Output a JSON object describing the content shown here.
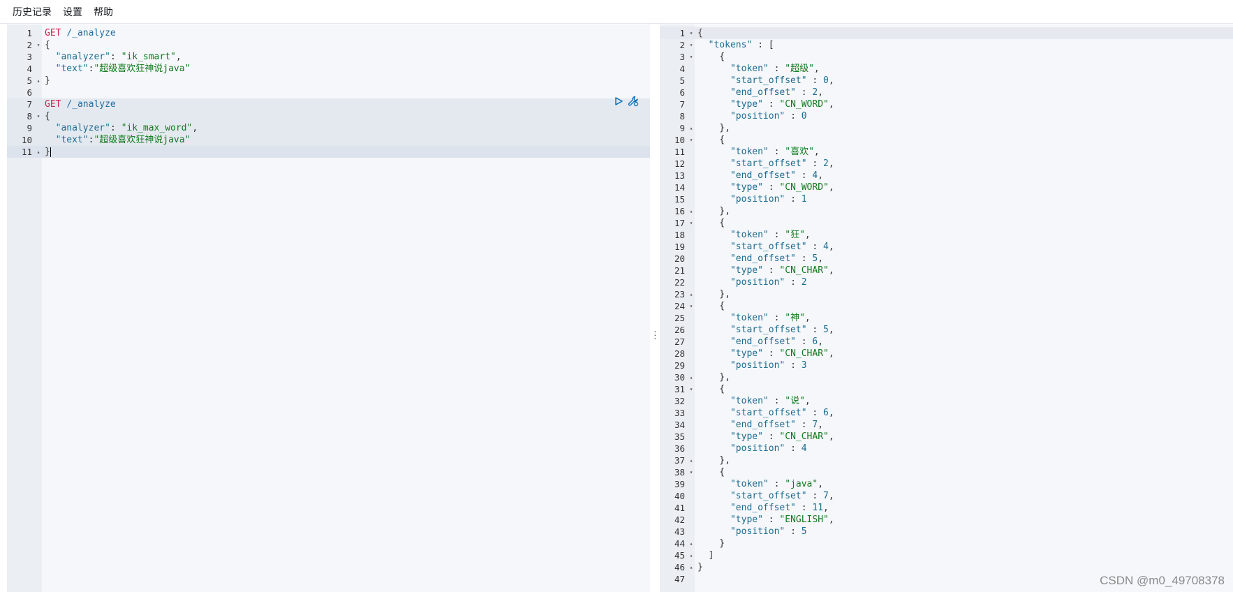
{
  "menubar": {
    "items": [
      "历史记录",
      "设置",
      "帮助"
    ]
  },
  "left_editor": {
    "lines": [
      {
        "n": "1",
        "fold": "",
        "tokens": [
          [
            "k-method",
            "GET"
          ],
          [
            "k-punc",
            " "
          ],
          [
            "k-path",
            "/_analyze"
          ]
        ]
      },
      {
        "n": "2",
        "fold": "▾",
        "tokens": [
          [
            "k-punc",
            "{"
          ]
        ]
      },
      {
        "n": "3",
        "fold": "",
        "tokens": [
          [
            "k-punc",
            "  "
          ],
          [
            "k-key",
            "\"analyzer\""
          ],
          [
            "k-punc",
            ": "
          ],
          [
            "k-str",
            "\"ik_smart\""
          ],
          [
            "k-punc",
            ","
          ]
        ]
      },
      {
        "n": "4",
        "fold": "",
        "tokens": [
          [
            "k-punc",
            "  "
          ],
          [
            "k-key",
            "\"text\""
          ],
          [
            "k-punc",
            ":"
          ],
          [
            "k-str",
            "\"超级喜欢狂神说java\""
          ]
        ]
      },
      {
        "n": "5",
        "fold": "▴",
        "tokens": [
          [
            "k-punc",
            "}"
          ]
        ]
      },
      {
        "n": "6",
        "fold": "",
        "tokens": []
      },
      {
        "n": "7",
        "fold": "",
        "tokens": [
          [
            "k-method",
            "GET"
          ],
          [
            "k-punc",
            " "
          ],
          [
            "k-path",
            "/_analyze"
          ]
        ],
        "hl": true
      },
      {
        "n": "8",
        "fold": "▾",
        "tokens": [
          [
            "k-punc",
            "{"
          ]
        ],
        "hl": true
      },
      {
        "n": "9",
        "fold": "",
        "tokens": [
          [
            "k-punc",
            "  "
          ],
          [
            "k-key",
            "\"analyzer\""
          ],
          [
            "k-punc",
            ": "
          ],
          [
            "k-str",
            "\"ik_max_word\""
          ],
          [
            "k-punc",
            ","
          ]
        ],
        "hl": true
      },
      {
        "n": "10",
        "fold": "",
        "tokens": [
          [
            "k-punc",
            "  "
          ],
          [
            "k-key",
            "\"text\""
          ],
          [
            "k-punc",
            ":"
          ],
          [
            "k-str",
            "\"超级喜欢狂神说java\""
          ]
        ],
        "hl": true
      },
      {
        "n": "11",
        "fold": "▴",
        "tokens": [
          [
            "k-punc",
            "}"
          ]
        ],
        "cur": true
      }
    ]
  },
  "right_editor": {
    "lines": [
      {
        "n": "1",
        "fold": "▾",
        "tokens": [
          [
            "k-punc",
            "{"
          ]
        ]
      },
      {
        "n": "2",
        "fold": "▾",
        "tokens": [
          [
            "k-punc",
            "  "
          ],
          [
            "k-key",
            "\"tokens\""
          ],
          [
            "k-punc",
            " : ["
          ]
        ]
      },
      {
        "n": "3",
        "fold": "▾",
        "tokens": [
          [
            "k-punc",
            "    {"
          ]
        ]
      },
      {
        "n": "4",
        "fold": "",
        "tokens": [
          [
            "k-punc",
            "      "
          ],
          [
            "k-key",
            "\"token\""
          ],
          [
            "k-punc",
            " : "
          ],
          [
            "k-str",
            "\"超级\""
          ],
          [
            "k-punc",
            ","
          ]
        ]
      },
      {
        "n": "5",
        "fold": "",
        "tokens": [
          [
            "k-punc",
            "      "
          ],
          [
            "k-key",
            "\"start_offset\""
          ],
          [
            "k-punc",
            " : "
          ],
          [
            "k-num",
            "0"
          ],
          [
            "k-punc",
            ","
          ]
        ]
      },
      {
        "n": "6",
        "fold": "",
        "tokens": [
          [
            "k-punc",
            "      "
          ],
          [
            "k-key",
            "\"end_offset\""
          ],
          [
            "k-punc",
            " : "
          ],
          [
            "k-num",
            "2"
          ],
          [
            "k-punc",
            ","
          ]
        ]
      },
      {
        "n": "7",
        "fold": "",
        "tokens": [
          [
            "k-punc",
            "      "
          ],
          [
            "k-key",
            "\"type\""
          ],
          [
            "k-punc",
            " : "
          ],
          [
            "k-str",
            "\"CN_WORD\""
          ],
          [
            "k-punc",
            ","
          ]
        ]
      },
      {
        "n": "8",
        "fold": "",
        "tokens": [
          [
            "k-punc",
            "      "
          ],
          [
            "k-key",
            "\"position\""
          ],
          [
            "k-punc",
            " : "
          ],
          [
            "k-num",
            "0"
          ]
        ]
      },
      {
        "n": "9",
        "fold": "▴",
        "tokens": [
          [
            "k-punc",
            "    },"
          ]
        ]
      },
      {
        "n": "10",
        "fold": "▾",
        "tokens": [
          [
            "k-punc",
            "    {"
          ]
        ]
      },
      {
        "n": "11",
        "fold": "",
        "tokens": [
          [
            "k-punc",
            "      "
          ],
          [
            "k-key",
            "\"token\""
          ],
          [
            "k-punc",
            " : "
          ],
          [
            "k-str",
            "\"喜欢\""
          ],
          [
            "k-punc",
            ","
          ]
        ]
      },
      {
        "n": "12",
        "fold": "",
        "tokens": [
          [
            "k-punc",
            "      "
          ],
          [
            "k-key",
            "\"start_offset\""
          ],
          [
            "k-punc",
            " : "
          ],
          [
            "k-num",
            "2"
          ],
          [
            "k-punc",
            ","
          ]
        ]
      },
      {
        "n": "13",
        "fold": "",
        "tokens": [
          [
            "k-punc",
            "      "
          ],
          [
            "k-key",
            "\"end_offset\""
          ],
          [
            "k-punc",
            " : "
          ],
          [
            "k-num",
            "4"
          ],
          [
            "k-punc",
            ","
          ]
        ]
      },
      {
        "n": "14",
        "fold": "",
        "tokens": [
          [
            "k-punc",
            "      "
          ],
          [
            "k-key",
            "\"type\""
          ],
          [
            "k-punc",
            " : "
          ],
          [
            "k-str",
            "\"CN_WORD\""
          ],
          [
            "k-punc",
            ","
          ]
        ]
      },
      {
        "n": "15",
        "fold": "",
        "tokens": [
          [
            "k-punc",
            "      "
          ],
          [
            "k-key",
            "\"position\""
          ],
          [
            "k-punc",
            " : "
          ],
          [
            "k-num",
            "1"
          ]
        ]
      },
      {
        "n": "16",
        "fold": "▴",
        "tokens": [
          [
            "k-punc",
            "    },"
          ]
        ]
      },
      {
        "n": "17",
        "fold": "▾",
        "tokens": [
          [
            "k-punc",
            "    {"
          ]
        ]
      },
      {
        "n": "18",
        "fold": "",
        "tokens": [
          [
            "k-punc",
            "      "
          ],
          [
            "k-key",
            "\"token\""
          ],
          [
            "k-punc",
            " : "
          ],
          [
            "k-str",
            "\"狂\""
          ],
          [
            "k-punc",
            ","
          ]
        ]
      },
      {
        "n": "19",
        "fold": "",
        "tokens": [
          [
            "k-punc",
            "      "
          ],
          [
            "k-key",
            "\"start_offset\""
          ],
          [
            "k-punc",
            " : "
          ],
          [
            "k-num",
            "4"
          ],
          [
            "k-punc",
            ","
          ]
        ]
      },
      {
        "n": "20",
        "fold": "",
        "tokens": [
          [
            "k-punc",
            "      "
          ],
          [
            "k-key",
            "\"end_offset\""
          ],
          [
            "k-punc",
            " : "
          ],
          [
            "k-num",
            "5"
          ],
          [
            "k-punc",
            ","
          ]
        ]
      },
      {
        "n": "21",
        "fold": "",
        "tokens": [
          [
            "k-punc",
            "      "
          ],
          [
            "k-key",
            "\"type\""
          ],
          [
            "k-punc",
            " : "
          ],
          [
            "k-str",
            "\"CN_CHAR\""
          ],
          [
            "k-punc",
            ","
          ]
        ]
      },
      {
        "n": "22",
        "fold": "",
        "tokens": [
          [
            "k-punc",
            "      "
          ],
          [
            "k-key",
            "\"position\""
          ],
          [
            "k-punc",
            " : "
          ],
          [
            "k-num",
            "2"
          ]
        ]
      },
      {
        "n": "23",
        "fold": "▴",
        "tokens": [
          [
            "k-punc",
            "    },"
          ]
        ]
      },
      {
        "n": "24",
        "fold": "▾",
        "tokens": [
          [
            "k-punc",
            "    {"
          ]
        ]
      },
      {
        "n": "25",
        "fold": "",
        "tokens": [
          [
            "k-punc",
            "      "
          ],
          [
            "k-key",
            "\"token\""
          ],
          [
            "k-punc",
            " : "
          ],
          [
            "k-str",
            "\"神\""
          ],
          [
            "k-punc",
            ","
          ]
        ]
      },
      {
        "n": "26",
        "fold": "",
        "tokens": [
          [
            "k-punc",
            "      "
          ],
          [
            "k-key",
            "\"start_offset\""
          ],
          [
            "k-punc",
            " : "
          ],
          [
            "k-num",
            "5"
          ],
          [
            "k-punc",
            ","
          ]
        ]
      },
      {
        "n": "27",
        "fold": "",
        "tokens": [
          [
            "k-punc",
            "      "
          ],
          [
            "k-key",
            "\"end_offset\""
          ],
          [
            "k-punc",
            " : "
          ],
          [
            "k-num",
            "6"
          ],
          [
            "k-punc",
            ","
          ]
        ]
      },
      {
        "n": "28",
        "fold": "",
        "tokens": [
          [
            "k-punc",
            "      "
          ],
          [
            "k-key",
            "\"type\""
          ],
          [
            "k-punc",
            " : "
          ],
          [
            "k-str",
            "\"CN_CHAR\""
          ],
          [
            "k-punc",
            ","
          ]
        ]
      },
      {
        "n": "29",
        "fold": "",
        "tokens": [
          [
            "k-punc",
            "      "
          ],
          [
            "k-key",
            "\"position\""
          ],
          [
            "k-punc",
            " : "
          ],
          [
            "k-num",
            "3"
          ]
        ]
      },
      {
        "n": "30",
        "fold": "▴",
        "tokens": [
          [
            "k-punc",
            "    },"
          ]
        ]
      },
      {
        "n": "31",
        "fold": "▾",
        "tokens": [
          [
            "k-punc",
            "    {"
          ]
        ]
      },
      {
        "n": "32",
        "fold": "",
        "tokens": [
          [
            "k-punc",
            "      "
          ],
          [
            "k-key",
            "\"token\""
          ],
          [
            "k-punc",
            " : "
          ],
          [
            "k-str",
            "\"说\""
          ],
          [
            "k-punc",
            ","
          ]
        ]
      },
      {
        "n": "33",
        "fold": "",
        "tokens": [
          [
            "k-punc",
            "      "
          ],
          [
            "k-key",
            "\"start_offset\""
          ],
          [
            "k-punc",
            " : "
          ],
          [
            "k-num",
            "6"
          ],
          [
            "k-punc",
            ","
          ]
        ]
      },
      {
        "n": "34",
        "fold": "",
        "tokens": [
          [
            "k-punc",
            "      "
          ],
          [
            "k-key",
            "\"end_offset\""
          ],
          [
            "k-punc",
            " : "
          ],
          [
            "k-num",
            "7"
          ],
          [
            "k-punc",
            ","
          ]
        ]
      },
      {
        "n": "35",
        "fold": "",
        "tokens": [
          [
            "k-punc",
            "      "
          ],
          [
            "k-key",
            "\"type\""
          ],
          [
            "k-punc",
            " : "
          ],
          [
            "k-str",
            "\"CN_CHAR\""
          ],
          [
            "k-punc",
            ","
          ]
        ]
      },
      {
        "n": "36",
        "fold": "",
        "tokens": [
          [
            "k-punc",
            "      "
          ],
          [
            "k-key",
            "\"position\""
          ],
          [
            "k-punc",
            " : "
          ],
          [
            "k-num",
            "4"
          ]
        ]
      },
      {
        "n": "37",
        "fold": "▴",
        "tokens": [
          [
            "k-punc",
            "    },"
          ]
        ]
      },
      {
        "n": "38",
        "fold": "▾",
        "tokens": [
          [
            "k-punc",
            "    {"
          ]
        ]
      },
      {
        "n": "39",
        "fold": "",
        "tokens": [
          [
            "k-punc",
            "      "
          ],
          [
            "k-key",
            "\"token\""
          ],
          [
            "k-punc",
            " : "
          ],
          [
            "k-str",
            "\"java\""
          ],
          [
            "k-punc",
            ","
          ]
        ]
      },
      {
        "n": "40",
        "fold": "",
        "tokens": [
          [
            "k-punc",
            "      "
          ],
          [
            "k-key",
            "\"start_offset\""
          ],
          [
            "k-punc",
            " : "
          ],
          [
            "k-num",
            "7"
          ],
          [
            "k-punc",
            ","
          ]
        ]
      },
      {
        "n": "41",
        "fold": "",
        "tokens": [
          [
            "k-punc",
            "      "
          ],
          [
            "k-key",
            "\"end_offset\""
          ],
          [
            "k-punc",
            " : "
          ],
          [
            "k-num",
            "11"
          ],
          [
            "k-punc",
            ","
          ]
        ]
      },
      {
        "n": "42",
        "fold": "",
        "tokens": [
          [
            "k-punc",
            "      "
          ],
          [
            "k-key",
            "\"type\""
          ],
          [
            "k-punc",
            " : "
          ],
          [
            "k-str",
            "\"ENGLISH\""
          ],
          [
            "k-punc",
            ","
          ]
        ]
      },
      {
        "n": "43",
        "fold": "",
        "tokens": [
          [
            "k-punc",
            "      "
          ],
          [
            "k-key",
            "\"position\""
          ],
          [
            "k-punc",
            " : "
          ],
          [
            "k-num",
            "5"
          ]
        ]
      },
      {
        "n": "44",
        "fold": "▴",
        "tokens": [
          [
            "k-punc",
            "    }"
          ]
        ]
      },
      {
        "n": "45",
        "fold": "▴",
        "tokens": [
          [
            "k-punc",
            "  ]"
          ]
        ]
      },
      {
        "n": "46",
        "fold": "▴",
        "tokens": [
          [
            "k-punc",
            "}"
          ]
        ]
      },
      {
        "n": "47",
        "fold": "",
        "tokens": []
      }
    ]
  },
  "actions": {
    "run_icon": "play-icon",
    "wrench_icon": "wrench-icon"
  },
  "watermark": "CSDN @m0_49708378",
  "colors": {
    "method": "#c7254e",
    "path": "#1d6fa3",
    "key": "#1b6c91",
    "string": "#117a1e",
    "editor_bg": "#f5f7fa",
    "gutter_bg": "#ebeef3",
    "active_line": "#e4e9f0",
    "icon_blue": "#006bb8"
  }
}
